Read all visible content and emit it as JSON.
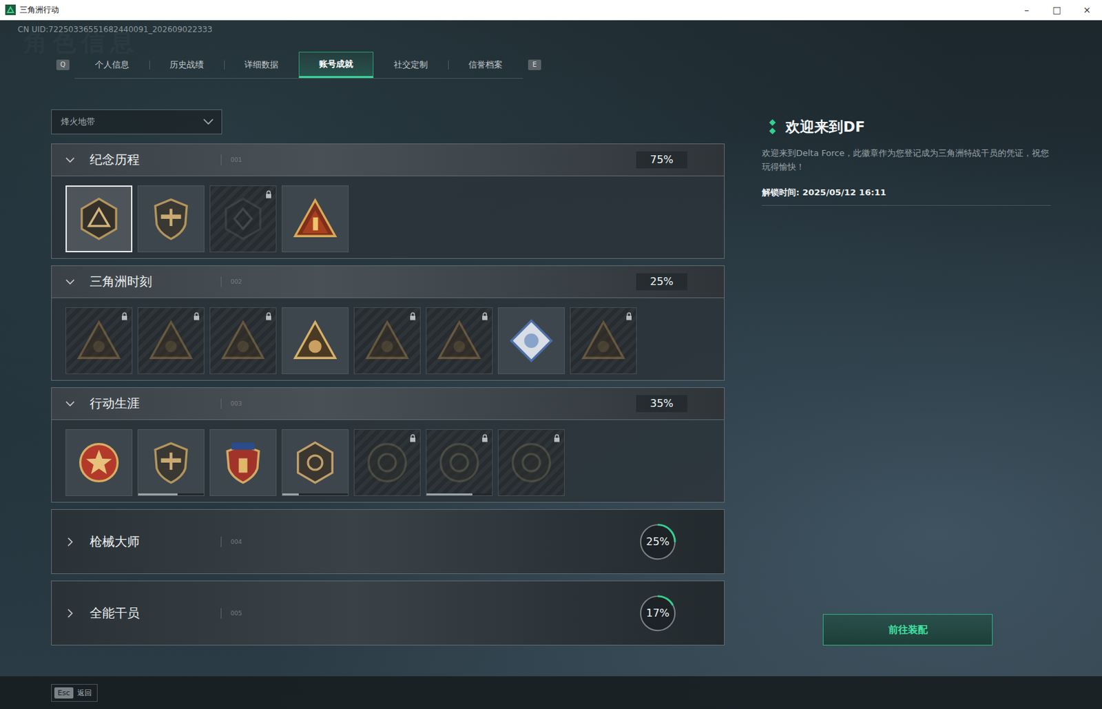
{
  "window": {
    "title": "三角洲行动",
    "controls": [
      "–",
      "□",
      "×"
    ]
  },
  "uid": "CN UID:72250336551682440091_202609022333",
  "watermark": "角色信息",
  "tabs": {
    "prev_key": "Q",
    "next_key": "E",
    "items": [
      {
        "label": "个人信息",
        "selected": false
      },
      {
        "label": "历史战绩",
        "selected": false
      },
      {
        "label": "详细数据",
        "selected": false
      },
      {
        "label": "账号成就",
        "selected": true
      },
      {
        "label": "社交定制",
        "selected": false
      },
      {
        "label": "信誉档案",
        "selected": false
      }
    ]
  },
  "mode_select": {
    "value": "烽火地带"
  },
  "sections": [
    {
      "title": "纪念历程",
      "index": "001",
      "progress": "75%",
      "expanded": true,
      "badges": [
        {
          "locked": false,
          "selected": true
        },
        {
          "locked": false,
          "selected": false
        },
        {
          "locked": true,
          "selected": false
        },
        {
          "locked": false,
          "selected": false
        }
      ]
    },
    {
      "title": "三角洲时刻",
      "index": "002",
      "progress": "25%",
      "expanded": true,
      "badges": [
        {
          "locked": true,
          "selected": false
        },
        {
          "locked": true,
          "selected": false
        },
        {
          "locked": true,
          "selected": false
        },
        {
          "locked": false,
          "selected": false
        },
        {
          "locked": true,
          "selected": false
        },
        {
          "locked": true,
          "selected": false
        },
        {
          "locked": false,
          "selected": false
        },
        {
          "locked": true,
          "selected": false
        }
      ]
    },
    {
      "title": "行动生涯",
      "index": "003",
      "progress": "35%",
      "expanded": true,
      "badges": [
        {
          "locked": false,
          "selected": false
        },
        {
          "locked": false,
          "selected": false,
          "level": 0.6
        },
        {
          "locked": false,
          "selected": false
        },
        {
          "locked": false,
          "selected": false,
          "level": 0.25
        },
        {
          "locked": true,
          "selected": false
        },
        {
          "locked": true,
          "selected": false,
          "level": 0.7
        },
        {
          "locked": true,
          "selected": false
        }
      ]
    },
    {
      "title": "枪械大师",
      "index": "004",
      "progress": "25%",
      "expanded": false,
      "level": 0.25,
      "badges": []
    },
    {
      "title": "全能干员",
      "index": "005",
      "progress": "17%",
      "expanded": false,
      "level": 0.17,
      "badges": []
    }
  ],
  "detail": {
    "title": "欢迎来到DF",
    "description": "欢迎来到Delta Force，此徽章作为您登记成为三角洲特战干员的凭证，祝您玩得愉快！",
    "unlock_time": "解锁时间: 2025/05/12 16:11",
    "button": "前往装配"
  },
  "footer": {
    "key": "Esc",
    "label": "返回"
  }
}
